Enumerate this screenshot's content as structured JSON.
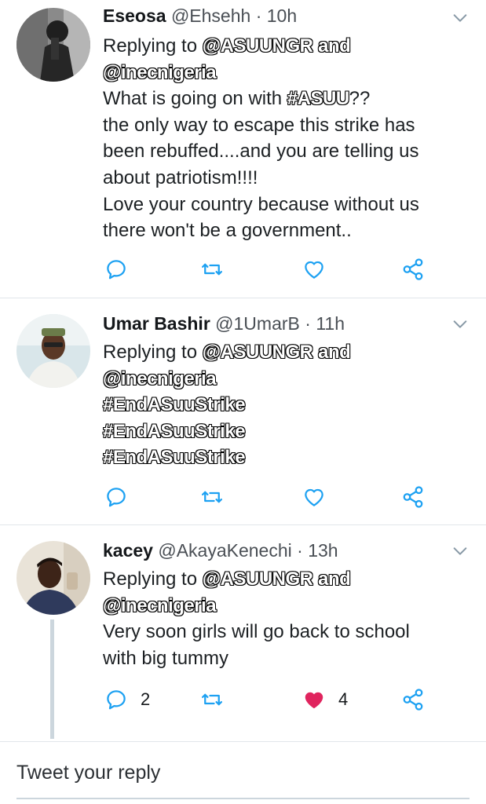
{
  "tweets": [
    {
      "name": "Eseosa",
      "handle": "@Ehsehh",
      "sep": "·",
      "time": "10h",
      "replying_prefix": "Replying to ",
      "mention1": "@ASUUNGR",
      "and": "and",
      "mention2": "@inecnigeria",
      "lines": [
        "What is going on with ",
        "#ASUU",
        "??",
        "the only way to escape this strike has",
        "been rebuffed....and you are telling us",
        "about patriotism!!!!",
        "Love your country because without us",
        "there won't be a government.."
      ],
      "actions": {
        "reply_count": "",
        "retweet_count": "",
        "like_count": ""
      }
    },
    {
      "name": "Umar Bashir",
      "handle": "@1UmarB",
      "sep": "·",
      "time": "11h",
      "replying_prefix": "Replying to ",
      "mention1": "@ASUUNGR",
      "and": "and",
      "mention2": "@inecnigeria",
      "hashtags": [
        "#EndASuuStrike",
        "#EndASuuStrike",
        "#EndASuuStrike"
      ],
      "actions": {
        "reply_count": "",
        "retweet_count": "",
        "like_count": ""
      }
    },
    {
      "name": "kacey",
      "handle": "@AkayaKenechi",
      "sep": "·",
      "time": "13h",
      "replying_prefix": "Replying to ",
      "mention1": "@ASUUNGR",
      "and": "and",
      "mention2": "@inecnigeria",
      "lines": [
        "Very soon girls will go back to school",
        "with big tummy"
      ],
      "actions": {
        "reply_count": "2",
        "retweet_count": "",
        "like_count": "4",
        "liked": true
      }
    }
  ],
  "icons": {
    "reply": "reply-icon",
    "retweet": "retweet-icon",
    "like": "heart-icon",
    "share": "share-icon",
    "more": "chevron-down-icon"
  },
  "colors": {
    "icon": "#1da1f2",
    "like_active": "#e0245e",
    "divider": "#e1e6ea",
    "thread": "#ccd6dd"
  },
  "reply_box": {
    "placeholder": "Tweet your reply"
  }
}
